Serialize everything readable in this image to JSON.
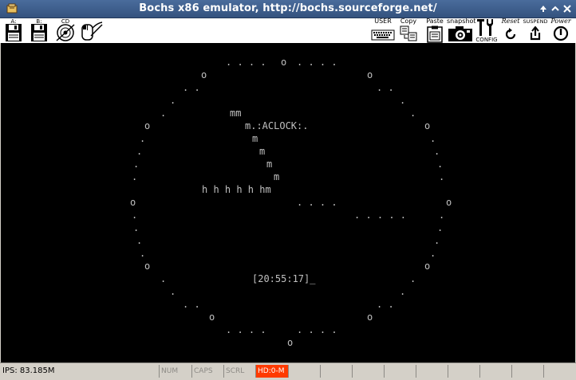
{
  "window": {
    "title": "Bochs x86 emulator, http://bochs.sourceforge.net/",
    "controls": [
      "minimize",
      "maximize",
      "close"
    ]
  },
  "toolbar": {
    "floppy_a_label": "A:",
    "floppy_b_label": "B:",
    "cdrom_label": "CD",
    "user_label": "USER",
    "copy_label": "Copy",
    "paste_label": "Paste",
    "snapshot_label": "snapshot",
    "config_label": "CONFIG",
    "reset_label": "Reset",
    "suspend_label": "SUSPEND",
    "power_label": "Power"
  },
  "console": {
    "program_label": "m.:ACLOCK:.",
    "time_display": "[20:55:17]_",
    "hour_hand": "h h h h h hm",
    "minute_marks": "mm",
    "cursor": "_"
  },
  "statusbar": {
    "ips": "IPS: 83.185M",
    "num": "NUM",
    "caps": "CAPS",
    "scrl": "SCRL",
    "hd": "HD:0-M"
  }
}
